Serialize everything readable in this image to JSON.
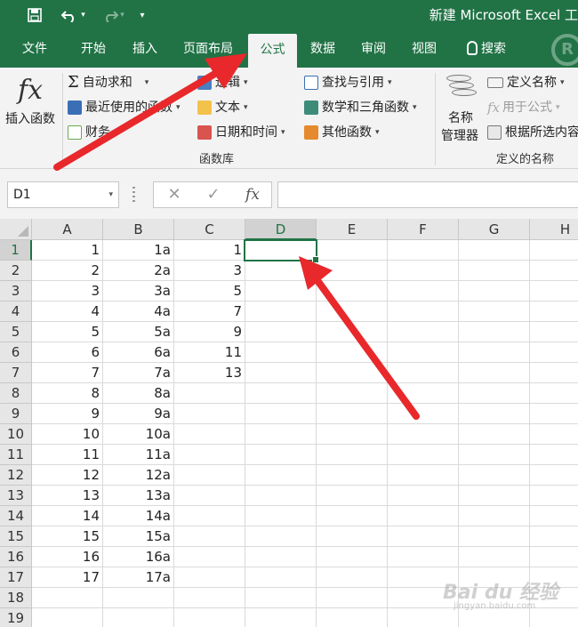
{
  "title_bar": {
    "title": "新建 Microsoft Excel 工",
    "icons": [
      "save-icon",
      "undo-icon",
      "redo-icon",
      "customize-qat-icon"
    ]
  },
  "tabs": [
    {
      "label": "文件"
    },
    {
      "label": "开始"
    },
    {
      "label": "插入"
    },
    {
      "label": "页面布局"
    },
    {
      "label": "公式",
      "active": true
    },
    {
      "label": "数据"
    },
    {
      "label": "审阅"
    },
    {
      "label": "视图"
    },
    {
      "label": "搜索"
    }
  ],
  "ribbon": {
    "insert_function": "插入函数",
    "library": {
      "autosum": "自动求和",
      "recent": "最近使用的函数",
      "financial": "财务",
      "logical": "逻辑",
      "text": "文本",
      "datetime": "日期和时间",
      "lookup": "查找与引用",
      "math": "数学和三角函数",
      "other": "其他函数",
      "group_label": "函数库"
    },
    "names": {
      "name_manager_line1": "名称",
      "name_manager_line2": "管理器",
      "define_name": "定义名称",
      "use_in_formula": "用于公式",
      "create_from_selection": "根据所选内容",
      "group_label": "定义的名称"
    }
  },
  "formula_bar": {
    "name_box": "D1",
    "cancel": "✕",
    "enter": "✓",
    "fx": "fx",
    "formula": ""
  },
  "sheet": {
    "columns": [
      "A",
      "B",
      "C",
      "D",
      "E",
      "F",
      "G",
      "H"
    ],
    "selected_column": "D",
    "selected_row": 1,
    "active_cell": "D1",
    "rows": [
      "1",
      "2",
      "3",
      "4",
      "5",
      "6",
      "7",
      "8",
      "9",
      "10",
      "11",
      "12",
      "13",
      "14",
      "15",
      "16",
      "17",
      "18",
      "19"
    ],
    "col_a": [
      "1",
      "2",
      "3",
      "4",
      "5",
      "6",
      "7",
      "8",
      "9",
      "10",
      "11",
      "12",
      "13",
      "14",
      "15",
      "16",
      "17"
    ],
    "col_b": [
      "1a",
      "2a",
      "3a",
      "4a",
      "5a",
      "6a",
      "7a",
      "8a",
      "9a",
      "10a",
      "11a",
      "12a",
      "13a",
      "14a",
      "15a",
      "16a",
      "17a"
    ],
    "col_c": [
      "1",
      "3",
      "5",
      "7",
      "9",
      "11",
      "13"
    ]
  },
  "colors": {
    "excel_green": "#217346",
    "arrow_red": "#e8282b"
  },
  "watermark": {
    "brand": "Bai du 经验",
    "url": "jingyan.baidu.com"
  }
}
